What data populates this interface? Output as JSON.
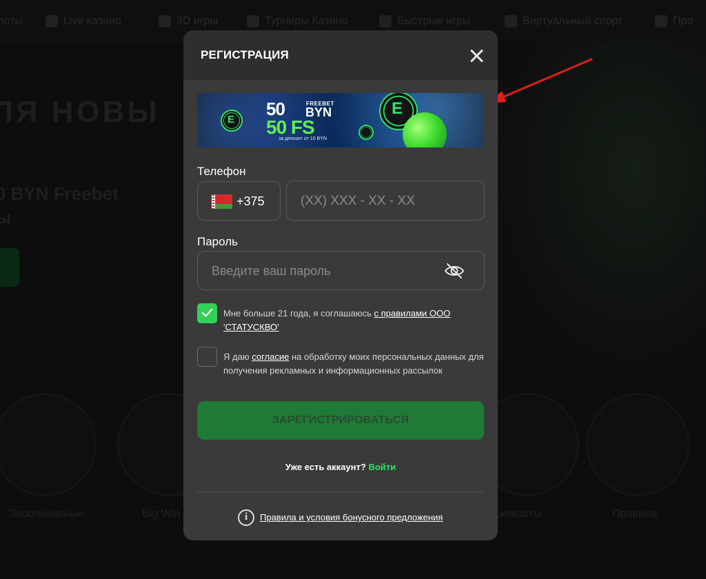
{
  "background": {
    "nav_items": [
      "лоты",
      "Live казино",
      "3D игры",
      "Турниры Казино",
      "Быстрые игры",
      "Виртуальный спорт",
      "Про"
    ],
    "hero_title": "ЛЯ НОВЫ",
    "hero_sub": "0 BYN Freebet",
    "hero_sub2": "ы",
    "categories": [
      "Эксклюзивные",
      "Big Win",
      "Джекпоты",
      "Правила"
    ]
  },
  "modal": {
    "title": "РЕГИСТРАЦИЯ",
    "close_icon": "close-icon",
    "banner": {
      "amount": "50",
      "freebet": "FREEBET",
      "currency": "BYN",
      "fs": "50 FS",
      "deposit": "за депозит от 10 BYN",
      "chip_letter": "E"
    },
    "phone_label": "Телефон",
    "country_code": "+375",
    "phone_placeholder": "(XX) XXX - XX - XX",
    "password_label": "Пароль",
    "password_placeholder": "Введите ваш пароль",
    "eye_icon": "eye-off-icon",
    "age_consent": {
      "checked": true,
      "text": "Мне больше 21 года, я соглашаюсь ",
      "link": "с правилами ООО 'СТАТУСКВО'"
    },
    "data_consent": {
      "checked": false,
      "text_before": "Я даю ",
      "link": "согласие",
      "text_after": " на обработку моих персональных данных для получения рекламных и информационных рассылок"
    },
    "register_button": "ЗАРЕГИСТРИРОВАТЬСЯ",
    "have_account": "Уже есть аккаунт?",
    "login_link": "Войти",
    "bonus_rules": "Правила и условия бонусного предложения"
  },
  "colors": {
    "accent": "#2fe36b",
    "button": "#1f7a37",
    "modal_bg": "#3a3a3a",
    "header_bg": "#2e2e2e",
    "arrow": "#e01c1c"
  }
}
